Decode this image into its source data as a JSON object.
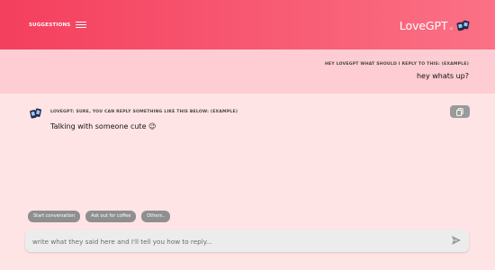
{
  "header": {
    "suggestions_label": "SUGGESTIONS",
    "brand_name": "LoveGPT",
    "brand_sub": "ai"
  },
  "question": {
    "label": "HEY LOVEGPT WHAT SHOULD I REPLY TO THIS: (EXAMPLE)",
    "text": "hey whats up?"
  },
  "answer": {
    "label": "LOVEGPT: SURE, YOU CAN REPLY SOMETHING LIKE THIS BELOW: (EXAMPLE)",
    "text": "Talking with someone cute 😉"
  },
  "chips": [
    "Start conversation",
    "Ask out for coffee",
    "Others.."
  ],
  "input": {
    "placeholder": "write what they said here and I'll tell you how to reply..."
  },
  "colors": {
    "header_start": "#f43f5e",
    "header_end": "#fb7185",
    "question_bg": "#fecdd3",
    "page_bg": "#ffe4e6",
    "chip_bg": "#8f8f8f"
  },
  "icons": [
    "menu-icon",
    "logo-icon",
    "avatar-icon",
    "copy-icon",
    "send-icon"
  ]
}
